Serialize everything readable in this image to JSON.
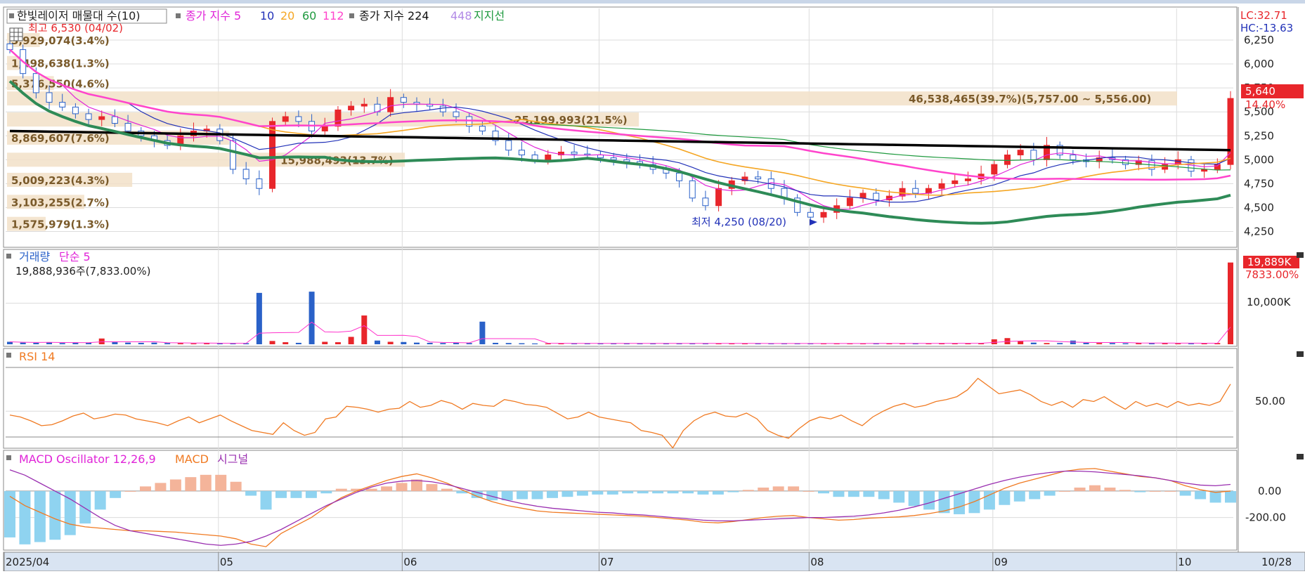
{
  "colors": {
    "up": "#e8262b",
    "down": "#2a61c8",
    "ma5": "#e024d8",
    "ma10": "#2232b8",
    "ma20": "#f5a623",
    "ma60": "#1f9a3f",
    "ma112": "#ff44cc",
    "ma224": "#000000",
    "ma448": "#b28be6",
    "support": "#2e8b57",
    "volume_ma": "#ff33cc",
    "rsi": "#f07a22",
    "macd": "#f07a22",
    "signal": "#9a2fb0",
    "osc_pos": "#f4b49a",
    "osc_neg": "#8fd3f0",
    "band": "#f2e1c8",
    "band_text": "#7a5a2a"
  },
  "price_panel": {
    "legend": {
      "title": "한빛레이저 매물대 수(10)",
      "ma_label": "종가 지수 5",
      "ma10": "10",
      "ma20": "20",
      "ma60": "60",
      "ma112": "112",
      "ma224_label": "종가 지수 224",
      "ma448": "448",
      "support": "지지선"
    },
    "high_note": "최고 6,530 (04/02)",
    "low_note": "최저 4,250 (08/20)",
    "lc": "LC:32.71",
    "hc": "HC:-13.63",
    "current_price": "5,640",
    "current_change": "14.40%",
    "y_ticks": [
      "6,250",
      "6,000",
      "5,750",
      "5,500",
      "5,250",
      "5,000",
      "4,750",
      "4,500",
      "4,250"
    ],
    "volume_profile": [
      {
        "label": "3,929,074(3.4%)",
        "price": 6250,
        "len": 0.028
      },
      {
        "label": "1,498,638(1.3%)",
        "price": 6010,
        "len": 0.011
      },
      {
        "label": "5,376,550(4.6%)",
        "price": 5800,
        "len": 0.04
      },
      {
        "label": "46,538,465(39.7%)(5,757.00 ~ 5,556.00)",
        "price": 5640,
        "len": 1.0
      },
      {
        "label": "25,199,993(21.5%)",
        "price": 5420,
        "len": 0.54
      },
      {
        "label": "8,869,607(7.6%)",
        "price": 5230,
        "len": 0.19
      },
      {
        "label": "15,988,493(13.7%)",
        "price": 5000,
        "len": 0.34
      },
      {
        "label": "5,009,223(4.3%)",
        "price": 4790,
        "len": 0.107
      },
      {
        "label": "3,103,255(2.7%)",
        "price": 4560,
        "len": 0.066
      },
      {
        "label": "1,575,979(1.3%)",
        "price": 4330,
        "len": 0.033
      }
    ]
  },
  "volume_panel": {
    "title": "거래량",
    "ma_label": "단순 5",
    "last_value": "19,888,936주(7,833.00%)",
    "badge_value": "19,889K",
    "badge_pct": "7833.00%",
    "y_tick": "10,000K"
  },
  "rsi_panel": {
    "title": "RSI 14",
    "y_tick": "50.00"
  },
  "macd_panel": {
    "title": "MACD Oscillator 12,26,9",
    "macd_label": "MACD",
    "signal_label": "시그널",
    "y_ticks": [
      "0.00",
      "-200.00"
    ]
  },
  "x_axis": {
    "labels": [
      "2025/04",
      "05",
      "06",
      "07",
      "08",
      "09",
      "10"
    ],
    "last": "10/28"
  },
  "chart_data": [
    {
      "type": "candlestick",
      "title": "한빛레이저",
      "x": [
        "2025/04",
        "05",
        "06",
        "07",
        "08",
        "09",
        "10",
        "10/28"
      ],
      "close_profile": [
        6150,
        5900,
        5700,
        5600,
        5550,
        5480,
        5420,
        5450,
        5380,
        5300,
        5250,
        5200,
        5150,
        5250,
        5300,
        5320,
        5200,
        4900,
        4800,
        4700,
        5400,
        5450,
        5400,
        5300,
        5350,
        5520,
        5560,
        5580,
        5500,
        5650,
        5600,
        5580,
        5560,
        5500,
        5450,
        5350,
        5300,
        5200,
        5100,
        5050,
        5000,
        5050,
        5080,
        5060,
        5050,
        5020,
        5000,
        4980,
        4950,
        4900,
        4860,
        4780,
        4600,
        4520,
        4700,
        4780,
        4820,
        4800,
        4700,
        4600,
        4450,
        4400,
        4450,
        4520,
        4600,
        4650,
        4580,
        4620,
        4700,
        4650,
        4700,
        4750,
        4780,
        4800,
        4850,
        4950,
        5050,
        5100,
        5000,
        5150,
        5050,
        5000,
        4980,
        5020,
        5000,
        4950,
        4990,
        4900,
        4950,
        5000,
        4880,
        4900,
        4950,
        5640
      ],
      "y_range": [
        4100,
        6580
      ],
      "high": {
        "value": 6530,
        "date": "04/02"
      },
      "low": {
        "value": 4250,
        "date": "08/20"
      },
      "ma224_endpoints": [
        5300,
        5100
      ]
    },
    {
      "type": "bar",
      "title": "거래량",
      "series": [
        {
          "name": "거래량",
          "values_k": [
            600,
            400,
            350,
            500,
            300,
            450,
            350,
            1400,
            500,
            400,
            350,
            400,
            300,
            250,
            200,
            300,
            250,
            200,
            250,
            12500,
            800,
            500,
            350,
            12800,
            600,
            500,
            1800,
            7000,
            900,
            600,
            550,
            400,
            350,
            300,
            400,
            300,
            5500,
            350,
            300,
            250,
            200,
            200,
            250,
            200,
            200,
            200,
            250,
            200,
            200,
            200,
            250,
            200,
            200,
            220,
            200,
            200,
            200,
            200,
            200,
            200,
            200,
            200,
            200,
            200,
            200,
            200,
            250,
            200,
            200,
            200,
            220,
            300,
            250,
            200,
            300,
            1200,
            1500,
            800,
            400,
            300,
            300,
            900,
            350,
            300,
            300,
            250,
            350,
            300,
            300,
            200,
            200,
            250,
            300,
            19889
          ]
        }
      ],
      "y_tick": 10000
    },
    {
      "type": "line",
      "title": "RSI 14",
      "series": [
        {
          "name": "RSI 14",
          "values": [
            46,
            44,
            40,
            35,
            36,
            40,
            45,
            48,
            42,
            44,
            47,
            46,
            42,
            40,
            38,
            35,
            40,
            44,
            38,
            42,
            46,
            40,
            35,
            30,
            28,
            26,
            38,
            30,
            25,
            28,
            42,
            44,
            55,
            54,
            52,
            49,
            52,
            53,
            60,
            54,
            56,
            61,
            58,
            52,
            58,
            56,
            55,
            62,
            60,
            57,
            56,
            54,
            48,
            42,
            44,
            49,
            44,
            42,
            40,
            38,
            30,
            28,
            25,
            12,
            30,
            40,
            46,
            49,
            45,
            44,
            48,
            42,
            30,
            25,
            22,
            32,
            40,
            44,
            42,
            46,
            40,
            35,
            44,
            50,
            55,
            58,
            54,
            56,
            60,
            62,
            65,
            72,
            84,
            76,
            68,
            70,
            72,
            67,
            60,
            56,
            60,
            54,
            62,
            60,
            65,
            58,
            52,
            60,
            55,
            58,
            54,
            60,
            56,
            58,
            56,
            60,
            78
          ]
        }
      ],
      "y_tick": 50
    },
    {
      "type": "line",
      "title": "MACD Oscillator 12,26,9",
      "series": [
        {
          "name": "MACD",
          "values": [
            -40,
            -110,
            -160,
            -210,
            -250,
            -270,
            -280,
            -290,
            -300,
            -300,
            -305,
            -310,
            -320,
            -330,
            -340,
            -360,
            -400,
            -420,
            -320,
            -260,
            -200,
            -120,
            -50,
            0,
            40,
            80,
            110,
            130,
            100,
            60,
            10,
            -40,
            -80,
            -110,
            -130,
            -150,
            -160,
            -165,
            -170,
            -175,
            -180,
            -185,
            -190,
            -200,
            -210,
            -220,
            -235,
            -240,
            -230,
            -215,
            -200,
            -190,
            -185,
            -200,
            -210,
            -220,
            -215,
            -205,
            -200,
            -195,
            -185,
            -170,
            -150,
            -120,
            -80,
            -30,
            20,
            60,
            90,
            120,
            150,
            165,
            170,
            150,
            130,
            110,
            100,
            80,
            40,
            10,
            -10,
            0
          ]
        },
        {
          "name": "시그널",
          "values": [
            160,
            120,
            60,
            0,
            -60,
            -130,
            -200,
            -260,
            -300,
            -320,
            -340,
            -360,
            -380,
            -400,
            -410,
            -400,
            -380,
            -340,
            -290,
            -230,
            -170,
            -110,
            -60,
            -10,
            30,
            60,
            75,
            80,
            70,
            50,
            20,
            -10,
            -40,
            -70,
            -95,
            -115,
            -130,
            -140,
            -150,
            -160,
            -165,
            -175,
            -180,
            -190,
            -200,
            -210,
            -220,
            -225,
            -225,
            -220,
            -215,
            -210,
            -205,
            -200,
            -200,
            -195,
            -190,
            -180,
            -165,
            -145,
            -120,
            -90,
            -55,
            -20,
            15,
            50,
            80,
            105,
            125,
            140,
            150,
            150,
            145,
            135,
            125,
            115,
            100,
            80,
            60,
            45,
            40,
            50
          ]
        }
      ],
      "y_ticks": [
        0,
        -200
      ]
    }
  ]
}
